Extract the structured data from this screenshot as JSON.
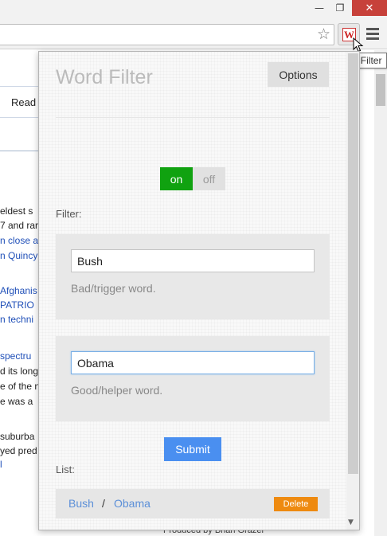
{
  "window": {
    "minimize_glyph": "—",
    "restore_glyph": "❐",
    "close_glyph": "✕"
  },
  "toolbar": {
    "star_glyph": "☆",
    "extension_logo": "W",
    "tooltip": "Word Filter"
  },
  "page": {
    "read_tab": "Read",
    "lines": [
      {
        "text": "eldest s",
        "style": "black"
      },
      {
        "text": "7 and rar",
        "style": "black"
      },
      {
        "text": "n close a",
        "style": "blue"
      },
      {
        "text": "n Quincy",
        "style": "blue"
      },
      {
        "text": "Afghanis",
        "style": "blue"
      },
      {
        "text": "PATRIO",
        "style": "blue"
      },
      {
        "text": "n techni",
        "style": "blue"
      },
      {
        "text": "spectru",
        "style": "blue"
      },
      {
        "text": "d its long",
        "style": "black"
      },
      {
        "text": "e of the n",
        "style": "black"
      },
      {
        "text": "e was a",
        "style": "black"
      },
      {
        "text": "suburba",
        "style": "black"
      },
      {
        "text": "yed pred",
        "style": "black"
      },
      {
        "text": "l",
        "style": "blue"
      }
    ],
    "bottom_text": "Produced by   Brian Grazer"
  },
  "popup": {
    "title": "Word Filter",
    "options_label": "Options",
    "toggle": {
      "on_label": "on",
      "off_label": "off",
      "state": "on"
    },
    "filter_label": "Filter:",
    "bad_word": {
      "value": "Bush",
      "hint": "Bad/trigger word."
    },
    "good_word": {
      "value": "Obama",
      "hint": "Good/helper word."
    },
    "submit_label": "Submit",
    "list_label": "List:",
    "list": [
      {
        "bad": "Bush",
        "separator": "/",
        "good": "Obama",
        "delete_label": "Delete"
      }
    ]
  },
  "colors": {
    "toggle_on": "#10a210",
    "submit": "#4a8ff0",
    "delete": "#ee8a10",
    "link": "#5b8fd8",
    "close_button": "#c7413a"
  }
}
